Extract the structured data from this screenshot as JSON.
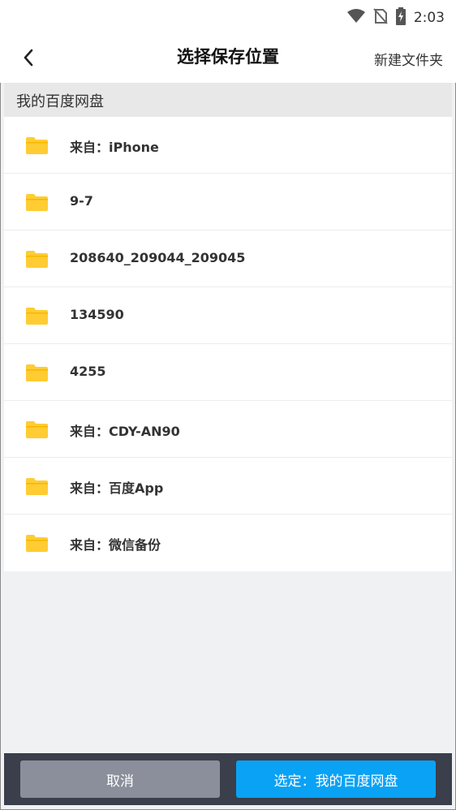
{
  "status_bar": {
    "time": "2:03"
  },
  "header": {
    "title": "选择保存位置",
    "new_folder_label": "新建文件夹"
  },
  "breadcrumb": {
    "label": "我的百度网盘"
  },
  "folders": [
    {
      "name": "来自：iPhone"
    },
    {
      "name": "9-7"
    },
    {
      "name": "208640_209044_209045"
    },
    {
      "name": "134590"
    },
    {
      "name": "4255"
    },
    {
      "name": "来自：CDY-AN90"
    },
    {
      "name": "来自：百度App"
    },
    {
      "name": "来自：微信备份"
    }
  ],
  "footer": {
    "cancel_label": "取消",
    "confirm_label": "选定：我的百度网盘"
  },
  "colors": {
    "folder": "#ffcc33",
    "confirm": "#0aa2f5",
    "cancel": "#8a8f9b",
    "footer_bg": "#3a3f4b"
  }
}
